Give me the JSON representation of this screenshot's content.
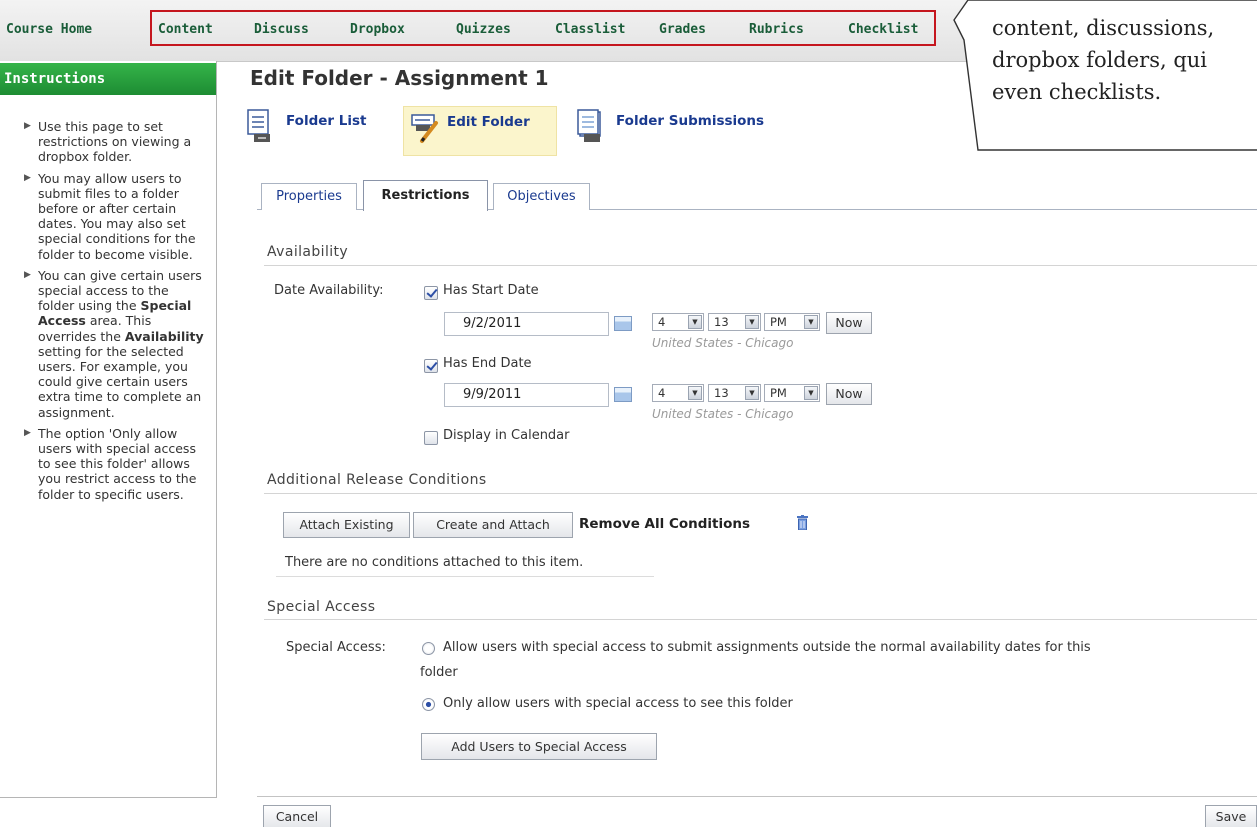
{
  "nav": {
    "items": [
      "Course Home",
      "Content",
      "Discuss",
      "Dropbox",
      "Quizzes",
      "Classlist",
      "Grades",
      "Rubrics",
      "Checklist"
    ]
  },
  "callout": {
    "text": "content, discussions,\ndropbox folders, qui\neven checklists."
  },
  "sidebar": {
    "title": "Instructions",
    "items": [
      "Use this page to set restrictions on viewing a dropbox folder.",
      "You may allow users to submit files to a folder before or after certain dates. You may also set special conditions for the folder to become visible.",
      "You can give certain users special access to the folder using the",
      "The option 'Only allow users with special access to see this folder' allows you restrict access to the folder to specific users."
    ],
    "item3": {
      "bold1": "Special Access",
      "mid": "area. This overrides the",
      "bold2": "Availability",
      "end": "setting for the selected users. For example, you could give certain users extra time to complete an assignment."
    }
  },
  "page": {
    "title": "Edit Folder - Assignment 1"
  },
  "toolbar": {
    "folder_list": "Folder List",
    "edit_folder": "Edit Folder",
    "folder_submissions": "Folder Submissions"
  },
  "tabs": {
    "properties": "Properties",
    "restrictions": "Restrictions",
    "objectives": "Objectives"
  },
  "availability": {
    "heading": "Availability",
    "date_label": "Date Availability:",
    "has_start_label": "Has Start Date",
    "has_start_checked": true,
    "start_date": "9/2/2011",
    "start_hour": "4",
    "start_minute": "13",
    "start_ampm": "PM",
    "has_end_label": "Has End Date",
    "has_end_checked": true,
    "end_date": "9/9/2011",
    "end_hour": "4",
    "end_minute": "13",
    "end_ampm": "PM",
    "now_label": "Now",
    "timezone": "United States - Chicago",
    "display_calendar_label": "Display in Calendar",
    "display_calendar_checked": false
  },
  "release": {
    "heading": "Additional Release Conditions",
    "attach_existing": "Attach Existing",
    "create_and_attach": "Create and Attach",
    "remove_all": "Remove All Conditions",
    "no_conditions": "There are no conditions attached to this item."
  },
  "special": {
    "heading": "Special Access",
    "label": "Special Access:",
    "option1_line1": "Allow users with special access to submit assignments outside the normal availability dates for this",
    "option1_line2": "folder",
    "option2": "Only allow users with special access to see this folder",
    "selected_option": 2,
    "add_users": "Add Users to Special Access"
  },
  "footer": {
    "cancel": "Cancel",
    "save": "Save"
  },
  "colors": {
    "nav_text": "#1a5d39",
    "nav_highlight": "#c5161e",
    "sidebar_header": "#2a9f3e",
    "link": "#1a3a8f",
    "edit_folder_bg": "#fbf5cc"
  }
}
